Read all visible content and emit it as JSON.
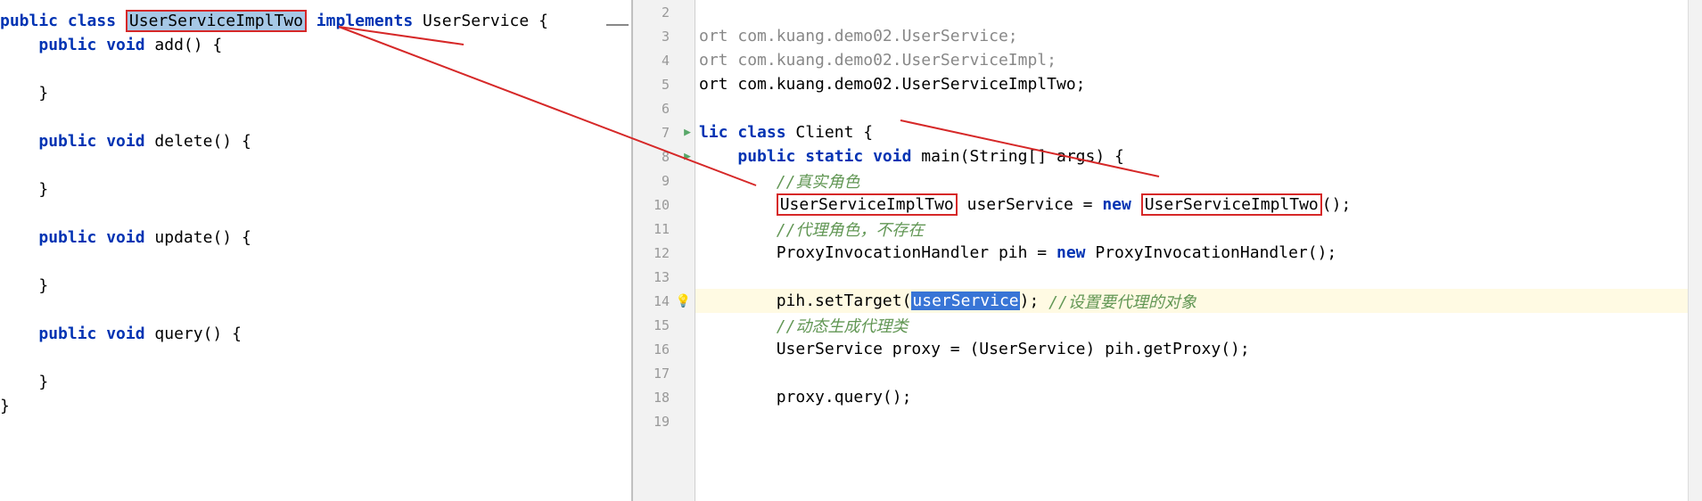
{
  "left": {
    "l1_kw_public": "public ",
    "l1_kw_class": "class ",
    "l1_classname": "UserServiceImplTwo",
    "l1_kw_impl": " implements ",
    "l1_iface": "UserService ",
    "l1_brace": "{",
    "l2_indent": "    ",
    "l2_kw_public": "public ",
    "l2_kw_void": "void ",
    "l2_mth": "add",
    "l2_rest": "() {",
    "l4_indent": "    ",
    "l4_brace": "}",
    "l6_indent": "    ",
    "l6_kw_public": "public ",
    "l6_kw_void": "void ",
    "l6_mth": "delete",
    "l6_rest": "() {",
    "l8_indent": "    ",
    "l8_brace": "}",
    "l10_indent": "    ",
    "l10_kw_public": "public ",
    "l10_kw_void": "void ",
    "l10_mth": "update",
    "l10_rest": "() {",
    "l12_indent": "    ",
    "l12_brace": "}",
    "l14_indent": "    ",
    "l14_kw_public": "public ",
    "l14_kw_void": "void ",
    "l14_mth": "query",
    "l14_rest": "() {",
    "l16_indent": "    ",
    "l16_brace": "}",
    "l17_brace": "}"
  },
  "gutter": {
    "n2": "2",
    "n3": "3",
    "n4": "4",
    "n5": "5",
    "n6": "6",
    "n7": "7",
    "n8": "8",
    "n9": "9",
    "n10": "10",
    "n11": "11",
    "n12": "12",
    "n13": "13",
    "n14": "14",
    "n15": "15",
    "n16": "16",
    "n17": "17",
    "n18": "18",
    "n19": "19"
  },
  "right": {
    "r3_ort": "ort ",
    "r3_pkg": "com.kuang.demo02.UserService",
    "r3_semi": ";",
    "r4_ort": "ort ",
    "r4_pkg": "com.kuang.demo02.UserServiceImpl",
    "r4_semi": ";",
    "r5_ort": "ort ",
    "r5_pkg": "com.kuang.demo02.UserServiceImplTwo",
    "r5_semi": ";",
    "r7_lic": "lic ",
    "r7_kw_class": "class ",
    "r7_cls": "Client ",
    "r7_brace": "{",
    "r8_indent": "    ",
    "r8_kw_public": "public ",
    "r8_kw_static": "static ",
    "r8_kw_void": "void ",
    "r8_main": "main",
    "r8_args": "(String[] args) {",
    "r9_indent": "        ",
    "r9_cmt": "//真实角色",
    "r10_indent": "        ",
    "r10_type": "UserServiceImplTwo",
    "r10_var": " userService = ",
    "r10_kw_new": "new",
    "r10_sp": " ",
    "r10_ctor": "UserServiceImplTwo",
    "r10_rest": "();",
    "r11_indent": "        ",
    "r11_cmt": "//代理角色，不存在",
    "r12_indent": "        ",
    "r12_type": "ProxyInvocationHandler pih = ",
    "r12_kw_new": "new ",
    "r12_ctor": "ProxyInvocationHandler();",
    "r14_indent": "        ",
    "r14_call": "pih.setTarget(",
    "r14_arg": "userService",
    "r14_close": "); ",
    "r14_cmt": "//设置要代理的对象",
    "r15_indent": "        ",
    "r15_cmt": "//动态生成代理类",
    "r16_indent": "        ",
    "r16_txt": "UserService proxy = (UserService) pih.getProxy();",
    "r18_indent": "        ",
    "r18_txt": "proxy.query();"
  },
  "icons": {
    "run": "▶",
    "bulb": "💡"
  }
}
